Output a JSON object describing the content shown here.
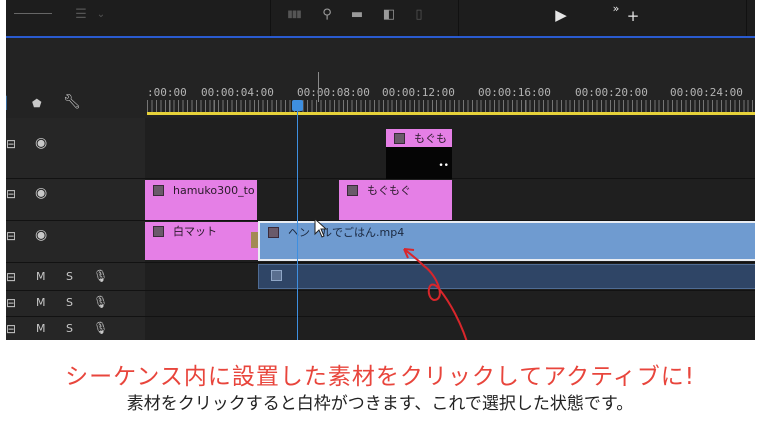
{
  "ruler": {
    "timecodes": [
      ":00:00",
      "00:00:04:00",
      "00:00:08:00",
      "00:00:12:00",
      "00:00:16:00",
      "00:00:20:00",
      "00:00:24:00"
    ]
  },
  "clips": {
    "mogumogu_top": "もぐも",
    "hamuko": "hamuko300_to",
    "mogumogu_mid": "もぐもぐ",
    "shiromat": "白マット",
    "selected_video": "ヘン　ルでごはん.mp4"
  },
  "tracks": {
    "audio_m": "M",
    "audio_s": "S"
  },
  "caption": {
    "main": "シーケンス内に設置した素材をクリックしてアクティブに!",
    "sub": "素材をクリックすると白枠がつきます、これで選択した状態です。"
  },
  "colors": {
    "clip_pink": "#e57fe6",
    "clip_blue": "#6f9bd0",
    "playhead": "#3e8fe0",
    "work_area": "#e7d23a",
    "caption_red": "#e8453c",
    "annotation_arrow": "#d8262b"
  },
  "icons": {
    "toolbar": [
      "menu-icon",
      "chevron-down-icon",
      "bars-icon",
      "search-icon",
      "folder-icon",
      "new-item-icon",
      "trash-icon",
      "play-icon",
      "more-icon",
      "add-icon"
    ],
    "track_header": [
      "marker-icon",
      "wrench-icon",
      "film-icon",
      "eye-icon",
      "mic-icon"
    ]
  }
}
